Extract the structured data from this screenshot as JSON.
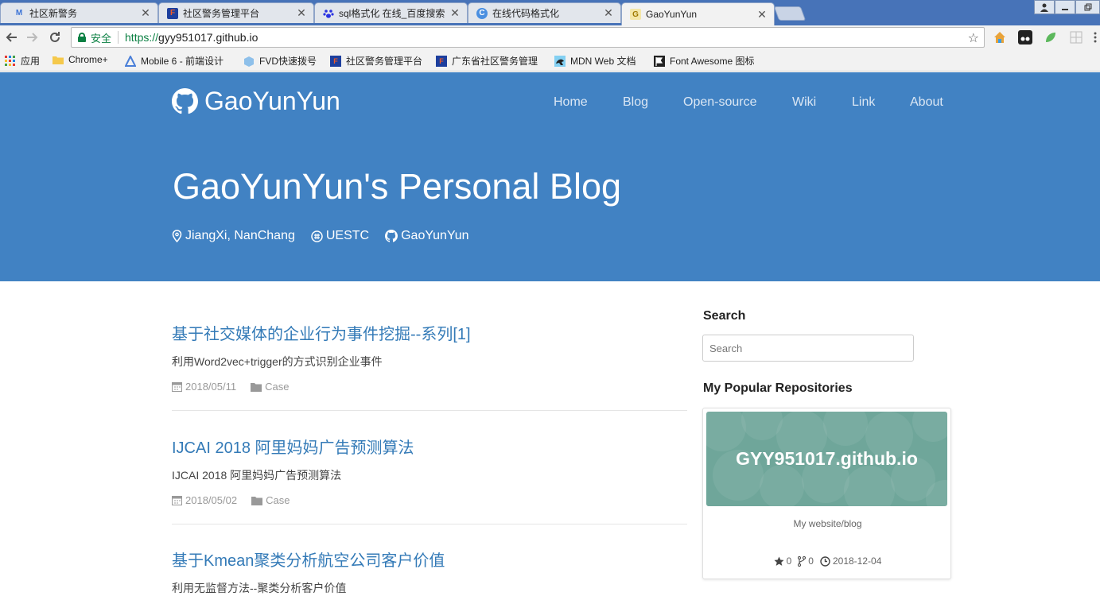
{
  "browser": {
    "tabs": [
      {
        "title": "社区新警务",
        "favicon": "M"
      },
      {
        "title": "社区警务管理平台",
        "favicon": "F"
      },
      {
        "title": "sql格式化 在线_百度搜索",
        "favicon": "paw"
      },
      {
        "title": "在线代码格式化",
        "favicon": "C"
      },
      {
        "title": "GaoYunYun",
        "favicon": "G"
      }
    ],
    "close_glyph": "✕",
    "url_scheme": "https://",
    "url_host": "gyy951017.github.io",
    "secure_label": "安全",
    "bookmarks": [
      {
        "label": "应用"
      },
      {
        "label": "Chrome+"
      },
      {
        "label": "Mobile 6 - 前端设计"
      },
      {
        "label": "FVD快速拨号"
      },
      {
        "label": "社区警务管理平台"
      },
      {
        "label": "广东省社区警务管理"
      },
      {
        "label": "MDN Web 文档"
      },
      {
        "label": "Font Awesome 图标"
      }
    ]
  },
  "site": {
    "brand": "GaoYunYun",
    "nav": [
      "Home",
      "Blog",
      "Open-source",
      "Wiki",
      "Link",
      "About"
    ],
    "title": "GaoYunYun's Personal Blog",
    "meta": {
      "location": "JiangXi, NanChang",
      "school": "UESTC",
      "github": "GaoYunYun"
    },
    "accent_color": "#4182c3",
    "link_color": "#337ab7"
  },
  "posts": [
    {
      "title": "基于社交媒体的企业行为事件挖掘--系列[1]",
      "desc": "利用Word2vec+trigger的方式识别企业事件",
      "date": "2018/05/11",
      "category": "Case"
    },
    {
      "title": "IJCAI 2018 阿里妈妈广告预测算法",
      "desc": "IJCAI 2018 阿里妈妈广告预测算法",
      "date": "2018/05/02",
      "category": "Case"
    },
    {
      "title": "基于Kmean聚类分析航空公司客户价值",
      "desc": "利用无监督方法--聚类分析客户价值",
      "date": "",
      "category": ""
    }
  ],
  "sidebar": {
    "search_heading": "Search",
    "search_placeholder": "Search",
    "repos_heading": "My Popular Repositories",
    "repo": {
      "name": "GYY951017.github.io",
      "desc": "My website/blog",
      "stars": "0",
      "forks": "0",
      "updated": "2018-12-04"
    }
  }
}
